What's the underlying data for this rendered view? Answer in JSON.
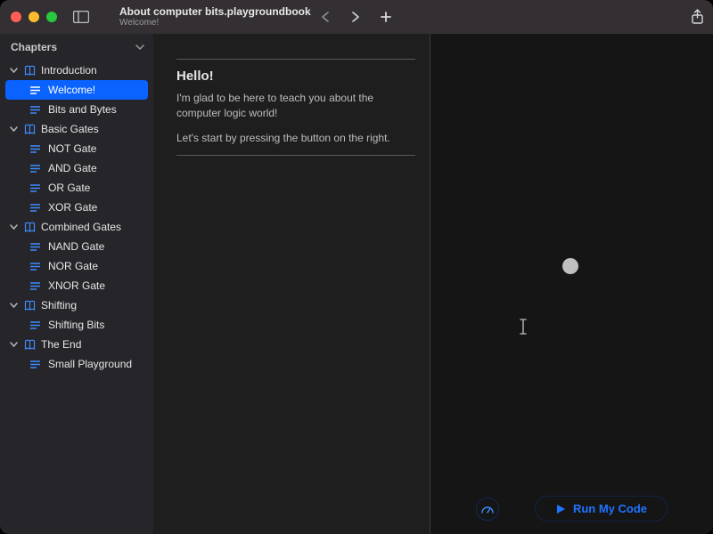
{
  "title": {
    "main": "About computer bits.playgroundbook",
    "sub": "Welcome!"
  },
  "sidebar": {
    "heading": "Chapters",
    "chapters": [
      {
        "label": "Introduction",
        "pages": [
          {
            "label": "Welcome!",
            "selected": true
          },
          {
            "label": "Bits and Bytes"
          }
        ]
      },
      {
        "label": "Basic Gates",
        "pages": [
          {
            "label": "NOT Gate"
          },
          {
            "label": "AND Gate"
          },
          {
            "label": "OR Gate"
          },
          {
            "label": "XOR Gate"
          }
        ]
      },
      {
        "label": "Combined Gates",
        "pages": [
          {
            "label": "NAND Gate"
          },
          {
            "label": "NOR Gate"
          },
          {
            "label": "XNOR Gate"
          }
        ]
      },
      {
        "label": "Shifting",
        "pages": [
          {
            "label": "Shifting Bits"
          }
        ]
      },
      {
        "label": "The End",
        "pages": [
          {
            "label": "Small Playground"
          }
        ]
      }
    ]
  },
  "content": {
    "heading": "Hello!",
    "p1": "I'm glad to be here to teach you about the computer logic world!",
    "p2": "Let's start by pressing the button on the right."
  },
  "footer": {
    "run_label": "Run My Code"
  }
}
